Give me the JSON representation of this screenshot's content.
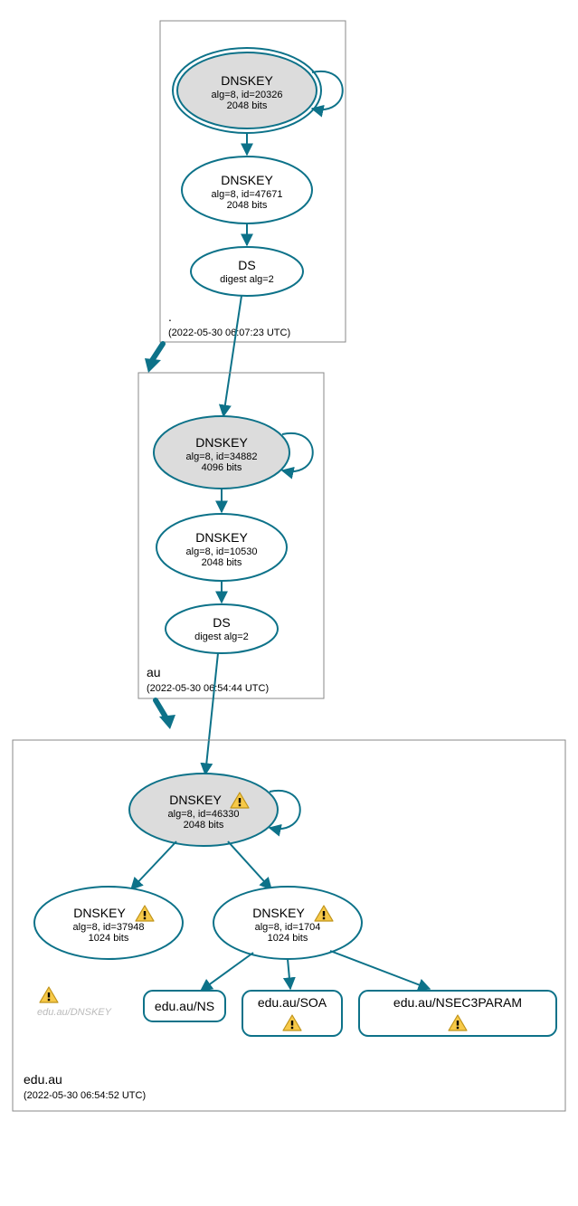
{
  "colors": {
    "stroke": "#0d7289",
    "keyFill": "#dcdcdc",
    "warnFill": "#f7c948",
    "warnStroke": "#c0941a"
  },
  "zones": {
    "root": {
      "label": ".",
      "timestamp": "(2022-05-30 06:07:23 UTC)",
      "nodes": {
        "ksk": {
          "title": "DNSKEY",
          "line1": "alg=8, id=20326",
          "line2": "2048 bits"
        },
        "zsk": {
          "title": "DNSKEY",
          "line1": "alg=8, id=47671",
          "line2": "2048 bits"
        },
        "ds": {
          "title": "DS",
          "line1": "digest alg=2"
        }
      }
    },
    "au": {
      "label": "au",
      "timestamp": "(2022-05-30 06:54:44 UTC)",
      "nodes": {
        "ksk": {
          "title": "DNSKEY",
          "line1": "alg=8, id=34882",
          "line2": "4096 bits"
        },
        "zsk": {
          "title": "DNSKEY",
          "line1": "alg=8, id=10530",
          "line2": "2048 bits"
        },
        "ds": {
          "title": "DS",
          "line1": "digest alg=2"
        }
      }
    },
    "eduau": {
      "label": "edu.au",
      "timestamp": "(2022-05-30 06:54:52 UTC)",
      "nodes": {
        "ksk": {
          "title": "DNSKEY",
          "line1": "alg=8, id=46330",
          "line2": "2048 bits"
        },
        "zsk1": {
          "title": "DNSKEY",
          "line1": "alg=8, id=37948",
          "line2": "1024 bits"
        },
        "zsk2": {
          "title": "DNSKEY",
          "line1": "alg=8, id=1704",
          "line2": "1024 bits"
        },
        "faded": "edu.au/DNSKEY",
        "rr": {
          "ns": "edu.au/NS",
          "soa": "edu.au/SOA",
          "nsec3": "edu.au/NSEC3PARAM"
        }
      }
    }
  },
  "chart_data": {
    "type": "graph",
    "description": "DNSSEC authentication / delegation graph for edu.au",
    "zones": [
      {
        "name": ".",
        "timestamp": "2022-05-30 06:07:23 UTC",
        "keys": [
          {
            "rrtype": "DNSKEY",
            "role": "KSK",
            "alg": 8,
            "id": 20326,
            "bits": 2048,
            "trust_anchor": true,
            "warn": false
          },
          {
            "rrtype": "DNSKEY",
            "role": "ZSK",
            "alg": 8,
            "id": 47671,
            "bits": 2048,
            "warn": false
          }
        ],
        "ds": [
          {
            "rrtype": "DS",
            "digest_alg": 2
          }
        ]
      },
      {
        "name": "au",
        "timestamp": "2022-05-30 06:54:44 UTC",
        "keys": [
          {
            "rrtype": "DNSKEY",
            "role": "KSK",
            "alg": 8,
            "id": 34882,
            "bits": 4096,
            "warn": false
          },
          {
            "rrtype": "DNSKEY",
            "role": "ZSK",
            "alg": 8,
            "id": 10530,
            "bits": 2048,
            "warn": false
          }
        ],
        "ds": [
          {
            "rrtype": "DS",
            "digest_alg": 2
          }
        ]
      },
      {
        "name": "edu.au",
        "timestamp": "2022-05-30 06:54:52 UTC",
        "keys": [
          {
            "rrtype": "DNSKEY",
            "role": "KSK",
            "alg": 8,
            "id": 46330,
            "bits": 2048,
            "warn": true
          },
          {
            "rrtype": "DNSKEY",
            "role": "ZSK",
            "alg": 8,
            "id": 37948,
            "bits": 1024,
            "warn": true
          },
          {
            "rrtype": "DNSKEY",
            "role": "ZSK",
            "alg": 8,
            "id": 1704,
            "bits": 1024,
            "warn": true
          }
        ],
        "rrsets": [
          {
            "name": "edu.au/NS",
            "warn": false
          },
          {
            "name": "edu.au/SOA",
            "warn": true
          },
          {
            "name": "edu.au/NSEC3PARAM",
            "warn": true
          },
          {
            "name": "edu.au/DNSKEY",
            "warn": true,
            "faded": true
          }
        ]
      }
    ],
    "edges": [
      {
        "from": "./DNSKEY/20326",
        "to": "./DNSKEY/20326",
        "kind": "self-sign"
      },
      {
        "from": "./DNSKEY/20326",
        "to": "./DNSKEY/47671",
        "kind": "sign"
      },
      {
        "from": "./DNSKEY/47671",
        "to": "./DS(au)",
        "kind": "sign"
      },
      {
        "from": "./DS(au)",
        "to": "au/DNSKEY/34882",
        "kind": "delegation"
      },
      {
        "from": ".",
        "to": "au",
        "kind": "zone-delegation"
      },
      {
        "from": "au/DNSKEY/34882",
        "to": "au/DNSKEY/34882",
        "kind": "self-sign"
      },
      {
        "from": "au/DNSKEY/34882",
        "to": "au/DNSKEY/10530",
        "kind": "sign"
      },
      {
        "from": "au/DNSKEY/10530",
        "to": "au/DS(edu.au)",
        "kind": "sign"
      },
      {
        "from": "au/DS(edu.au)",
        "to": "edu.au/DNSKEY/46330",
        "kind": "delegation"
      },
      {
        "from": "au",
        "to": "edu.au",
        "kind": "zone-delegation"
      },
      {
        "from": "edu.au/DNSKEY/46330",
        "to": "edu.au/DNSKEY/46330",
        "kind": "self-sign"
      },
      {
        "from": "edu.au/DNSKEY/46330",
        "to": "edu.au/DNSKEY/37948",
        "kind": "sign"
      },
      {
        "from": "edu.au/DNSKEY/46330",
        "to": "edu.au/DNSKEY/1704",
        "kind": "sign"
      },
      {
        "from": "edu.au/DNSKEY/1704",
        "to": "edu.au/NS",
        "kind": "sign"
      },
      {
        "from": "edu.au/DNSKEY/1704",
        "to": "edu.au/SOA",
        "kind": "sign"
      },
      {
        "from": "edu.au/DNSKEY/1704",
        "to": "edu.au/NSEC3PARAM",
        "kind": "sign"
      }
    ]
  }
}
